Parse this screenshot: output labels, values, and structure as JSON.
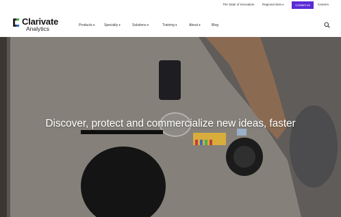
{
  "utility_nav": {
    "items": [
      {
        "label": "The State of Innovation",
        "dropdown": false
      },
      {
        "label": "Regional sites",
        "dropdown": true
      }
    ],
    "contact_label": "Contact us",
    "careers_label": "Careers"
  },
  "brand": {
    "name": "Clarivate",
    "sub": "Analytics",
    "accent": "#5b2bd6"
  },
  "main_nav": {
    "items": [
      {
        "label": "Products",
        "dropdown": true
      },
      {
        "label": "Specialty",
        "dropdown": true
      },
      {
        "label": "Solutions",
        "dropdown": true
      },
      {
        "label": "Training",
        "dropdown": true
      },
      {
        "label": "About",
        "dropdown": true
      },
      {
        "label": "Blog",
        "dropdown": false
      }
    ],
    "search_icon": "search-icon"
  },
  "hero": {
    "headline": "Discover, protect and commercialize new ideas, faster"
  }
}
